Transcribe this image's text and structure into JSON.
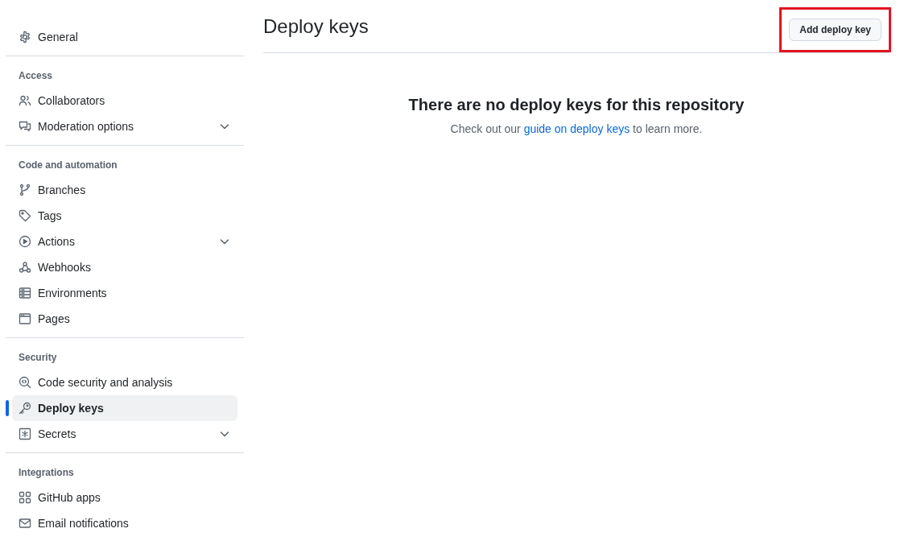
{
  "sidebar": {
    "sections": [
      {
        "items": [
          {
            "label": "General",
            "expandable": false,
            "selected": false
          }
        ]
      },
      {
        "heading": "Access",
        "items": [
          {
            "label": "Collaborators",
            "expandable": false,
            "selected": false
          },
          {
            "label": "Moderation options",
            "expandable": true,
            "selected": false
          }
        ]
      },
      {
        "heading": "Code and automation",
        "items": [
          {
            "label": "Branches",
            "expandable": false,
            "selected": false
          },
          {
            "label": "Tags",
            "expandable": false,
            "selected": false
          },
          {
            "label": "Actions",
            "expandable": true,
            "selected": false
          },
          {
            "label": "Webhooks",
            "expandable": false,
            "selected": false
          },
          {
            "label": "Environments",
            "expandable": false,
            "selected": false
          },
          {
            "label": "Pages",
            "expandable": false,
            "selected": false
          }
        ]
      },
      {
        "heading": "Security",
        "items": [
          {
            "label": "Code security and analysis",
            "expandable": false,
            "selected": false
          },
          {
            "label": "Deploy keys",
            "expandable": false,
            "selected": true
          },
          {
            "label": "Secrets",
            "expandable": true,
            "selected": false
          }
        ]
      },
      {
        "heading": "Integrations",
        "items": [
          {
            "label": "GitHub apps",
            "expandable": false,
            "selected": false
          },
          {
            "label": "Email notifications",
            "expandable": false,
            "selected": false
          }
        ]
      }
    ]
  },
  "page": {
    "title": "Deploy keys",
    "button": {
      "label": "Add deploy key",
      "highlighted": true
    }
  },
  "empty_state": {
    "title": "There are no deploy keys for this repository",
    "text_before": "Check out our",
    "link": "guide on deploy keys",
    "text_after": "to learn more."
  }
}
